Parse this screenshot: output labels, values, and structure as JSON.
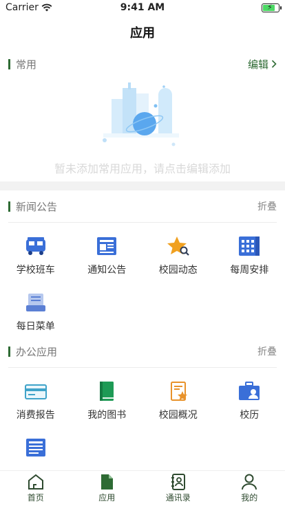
{
  "status": {
    "carrier": "Carrier",
    "time": "9:41 AM"
  },
  "header": {
    "title": "应用"
  },
  "common": {
    "title": "常用",
    "edit_label": "编辑",
    "empty_text": "暂未添加常用应用，请点击编辑添加"
  },
  "news": {
    "title": "新闻公告",
    "collapse_label": "折叠",
    "items": [
      {
        "label": "学校班车",
        "icon": "bus-icon"
      },
      {
        "label": "通知公告",
        "icon": "newspaper-icon"
      },
      {
        "label": "校园动态",
        "icon": "star-search-icon"
      },
      {
        "label": "每周安排",
        "icon": "calendar-icon"
      },
      {
        "label": "每日菜单",
        "icon": "menu-tray-icon"
      }
    ]
  },
  "office": {
    "title": "办公应用",
    "collapse_label": "折叠",
    "items": [
      {
        "label": "消费报告",
        "icon": "card-icon"
      },
      {
        "label": "我的图书",
        "icon": "book-icon"
      },
      {
        "label": "校园概况",
        "icon": "document-star-icon"
      },
      {
        "label": "校历",
        "icon": "briefcase-user-icon"
      },
      {
        "label": "",
        "icon": "document-list-icon"
      }
    ]
  },
  "tabbar": {
    "items": [
      {
        "label": "首页",
        "icon": "home-icon"
      },
      {
        "label": "应用",
        "icon": "file-icon"
      },
      {
        "label": "通讯录",
        "icon": "contacts-icon"
      },
      {
        "label": "我的",
        "icon": "user-icon"
      }
    ]
  },
  "colors": {
    "accent": "#2e6b34",
    "blue": "#3a6fd8",
    "orange": "#f0a020"
  }
}
